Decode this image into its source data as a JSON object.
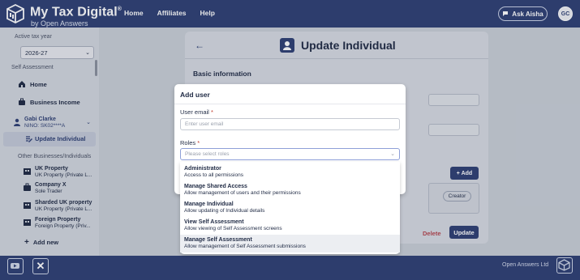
{
  "header": {
    "brand_title": "My Tax Digital",
    "brand_reg": "®",
    "brand_sub": "by Open Answers",
    "nav": [
      "Home",
      "Affiliates",
      "Help"
    ],
    "ask_label": "Ask Aisha",
    "avatar_initials": "GC"
  },
  "sidebar": {
    "active_tax_year_label": "Active tax year",
    "tax_year": "2026-27",
    "self_assessment_label": "Self Assessment",
    "home_label": "Home",
    "business_income_label": "Business Income",
    "person_name": "Gabi Clarke",
    "person_nino": "NINO: SK02****A",
    "update_individual_label": "Update Individual",
    "other_label": "Other Businesses/Individuals",
    "businesses": [
      {
        "name": "UK Property",
        "type": "UK Property (Private L..."
      },
      {
        "name": "Company X",
        "type": "Sole Trader"
      },
      {
        "name": "Sharded UK property",
        "type": "UK Property (Private L..."
      },
      {
        "name": "Foreign Property",
        "type": "Foreign Property (Priv..."
      }
    ],
    "add_new_label": "Add new"
  },
  "main": {
    "title": "Update Individual",
    "section_title": "Basic information",
    "add_label": "+ Add",
    "creator_badge": "Creator",
    "delete_label": "Delete",
    "update_label": "Update"
  },
  "modal": {
    "title": "Add user",
    "email_label": "User email",
    "email_placeholder": "Enter user email",
    "roles_label": "Roles",
    "roles_placeholder": "Please select roles",
    "required_mark": "*",
    "options": [
      {
        "title": "Administrator",
        "desc": "Access to all permissions"
      },
      {
        "title": "Manage Shared Access",
        "desc": "Allow management of users and their permissions"
      },
      {
        "title": "Manage Individual",
        "desc": "Allow updating of Individual details"
      },
      {
        "title": "View Self Assessment",
        "desc": "Allow viewing of Self Assessment screens"
      },
      {
        "title": "Manage Self Assessment",
        "desc": "Allow management of Self Assessment submissions"
      }
    ],
    "highlighted_index": 4
  },
  "footer": {
    "company": "Open Answers Ltd",
    "icons": [
      "youtube-icon",
      "x-icon",
      "open-answers-logo-icon"
    ]
  },
  "colors": {
    "primary": "#2e3f73",
    "danger": "#b5454e",
    "required": "#c0392b"
  }
}
